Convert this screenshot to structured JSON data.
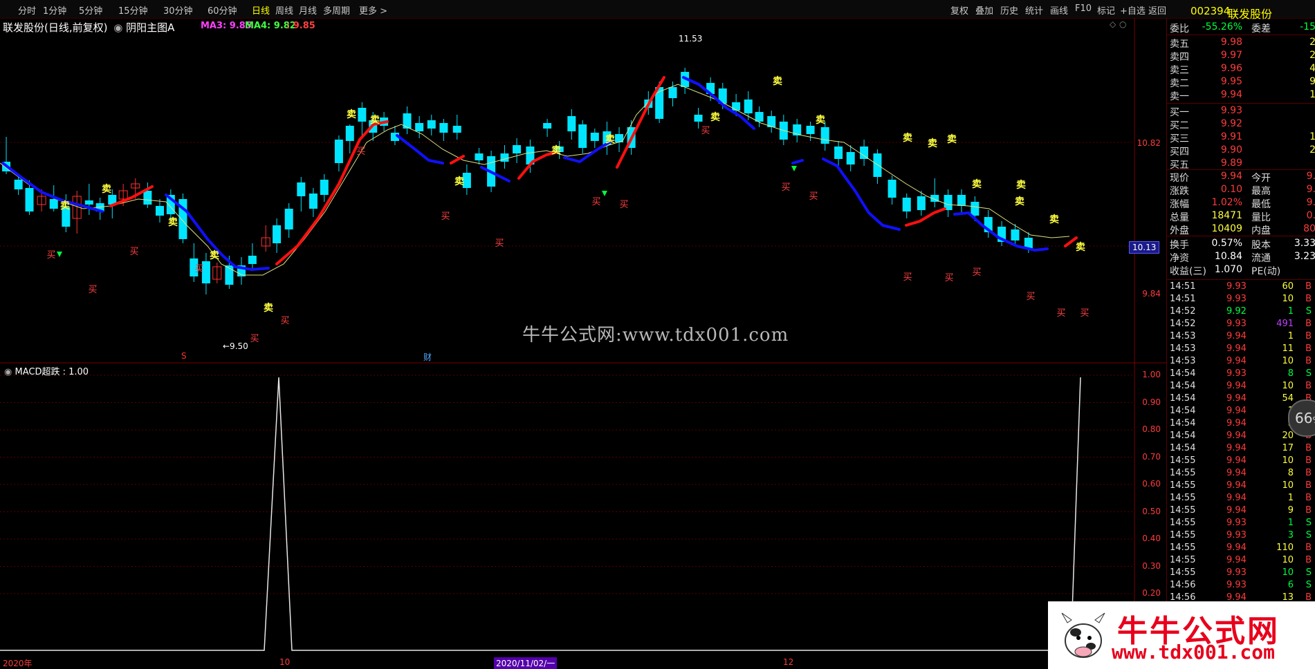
{
  "periods": [
    "分时",
    "1分钟",
    "5分钟",
    "15分钟",
    "30分钟",
    "60分钟",
    "日线",
    "周线",
    "月线",
    "多周期",
    "更多 >"
  ],
  "active_period": "日线",
  "tools": [
    "复权",
    "叠加",
    "历史",
    "统计",
    "画线",
    "F10",
    "标记",
    "+自选",
    "返回"
  ],
  "stock": {
    "code": "002394",
    "name": "联发股份"
  },
  "main_title": "联发股份(日线,前复权)",
  "indicator_name": "阴阳主图A",
  "legend": {
    "ma3": "MA3: 9.85",
    "ma4": "MA4: 9.82",
    "val": ": 9.85"
  },
  "sub_title": "MACD超跌 : 1.00",
  "watermark": "牛牛公式网:www.tdx001.com",
  "high_label": "11.53",
  "low_label": "←9.50",
  "markers": {
    "s": "S",
    "cai": "财"
  },
  "price_box": "10.13",
  "main_yaxis": [
    "10.82",
    "9.84"
  ],
  "sub_yaxis": [
    "1.00",
    "0.90",
    "0.80",
    "0.70",
    "0.60",
    "0.50",
    "0.40",
    "0.30",
    "0.20"
  ],
  "xaxis": {
    "year": "2020年",
    "m10": "10",
    "date_box": "2020/11/02/一",
    "m12": "12"
  },
  "quote": {
    "weibi": {
      "label": "委比",
      "value": "-55.26%",
      "label2": "委差",
      "value2": "-15"
    },
    "asks": [
      {
        "label": "卖五",
        "price": "9.98",
        "vol": "2"
      },
      {
        "label": "卖四",
        "price": "9.97",
        "vol": "2"
      },
      {
        "label": "卖三",
        "price": "9.96",
        "vol": "4"
      },
      {
        "label": "卖二",
        "price": "9.95",
        "vol": "9"
      },
      {
        "label": "卖一",
        "price": "9.94",
        "vol": "1"
      }
    ],
    "bids": [
      {
        "label": "买一",
        "price": "9.93",
        "vol": ""
      },
      {
        "label": "买二",
        "price": "9.92",
        "vol": ""
      },
      {
        "label": "买三",
        "price": "9.91",
        "vol": "1"
      },
      {
        "label": "买四",
        "price": "9.90",
        "vol": "2"
      },
      {
        "label": "买五",
        "price": "9.89",
        "vol": ""
      }
    ],
    "stats": [
      {
        "l1": "现价",
        "v1": "9.94",
        "l2": "今开",
        "v2": "9."
      },
      {
        "l1": "涨跌",
        "v1": "0.10",
        "l2": "最高",
        "v2": "9."
      },
      {
        "l1": "涨幅",
        "v1": "1.02%",
        "l2": "最低",
        "v2": "9."
      },
      {
        "l1": "总量",
        "v1": "18471",
        "l2": "量比",
        "v2": "0."
      },
      {
        "l1": "外盘",
        "v1": "10409",
        "l2": "内盘",
        "v2": "80"
      }
    ],
    "fundamentals": [
      {
        "l1": "换手",
        "v1": "0.57%",
        "l2": "股本",
        "v2": "3.33"
      },
      {
        "l1": "净资",
        "v1": "10.84",
        "l2": "流通",
        "v2": "3.23"
      },
      {
        "l1": "收益(三)",
        "v1": "1.070",
        "l2": "PE(动)",
        "v2": ""
      }
    ]
  },
  "ticks": [
    {
      "t": "14:51",
      "p": "9.93",
      "v": "60",
      "bs": "B"
    },
    {
      "t": "14:51",
      "p": "9.93",
      "v": "10",
      "bs": "B"
    },
    {
      "t": "14:52",
      "p": "9.92",
      "v": "1",
      "bs": "S"
    },
    {
      "t": "14:52",
      "p": "9.93",
      "v": "491",
      "bs": "B"
    },
    {
      "t": "14:53",
      "p": "9.94",
      "v": "1",
      "bs": "B"
    },
    {
      "t": "14:53",
      "p": "9.94",
      "v": "11",
      "bs": "B"
    },
    {
      "t": "14:53",
      "p": "9.94",
      "v": "10",
      "bs": "B"
    },
    {
      "t": "14:54",
      "p": "9.93",
      "v": "8",
      "bs": "S"
    },
    {
      "t": "14:54",
      "p": "9.94",
      "v": "10",
      "bs": "B"
    },
    {
      "t": "14:54",
      "p": "9.94",
      "v": "54",
      "bs": "B"
    },
    {
      "t": "14:54",
      "p": "9.94",
      "v": "1",
      "bs": "B"
    },
    {
      "t": "14:54",
      "p": "9.94",
      "v": "3",
      "bs": "B"
    },
    {
      "t": "14:54",
      "p": "9.94",
      "v": "20",
      "bs": "B"
    },
    {
      "t": "14:54",
      "p": "9.94",
      "v": "17",
      "bs": "B"
    },
    {
      "t": "14:55",
      "p": "9.94",
      "v": "10",
      "bs": "B"
    },
    {
      "t": "14:55",
      "p": "9.94",
      "v": "8",
      "bs": "B"
    },
    {
      "t": "14:55",
      "p": "9.94",
      "v": "10",
      "bs": "B"
    },
    {
      "t": "14:55",
      "p": "9.94",
      "v": "1",
      "bs": "B"
    },
    {
      "t": "14:55",
      "p": "9.94",
      "v": "9",
      "bs": "B"
    },
    {
      "t": "14:55",
      "p": "9.93",
      "v": "1",
      "bs": "S"
    },
    {
      "t": "14:55",
      "p": "9.93",
      "v": "3",
      "bs": "S"
    },
    {
      "t": "14:55",
      "p": "9.94",
      "v": "110",
      "bs": "B"
    },
    {
      "t": "14:55",
      "p": "9.94",
      "v": "10",
      "bs": "B"
    },
    {
      "t": "14:55",
      "p": "9.93",
      "v": "10",
      "bs": "S"
    },
    {
      "t": "14:56",
      "p": "9.93",
      "v": "6",
      "bs": "S"
    },
    {
      "t": "14:56",
      "p": "9.94",
      "v": "13",
      "bs": "B"
    }
  ],
  "zoom": "66",
  "logo": {
    "text": "牛牛公式网",
    "url": "www.tdx001.com"
  },
  "colors": {
    "up": "#ff3030",
    "down": "#00e5ff",
    "ma_up": "#ff1010",
    "ma_down": "#1010ff",
    "thin_ma": "#e0e080",
    "buy": "#ff4040",
    "sell": "#ffff40",
    "grid": "#5a0000"
  }
}
